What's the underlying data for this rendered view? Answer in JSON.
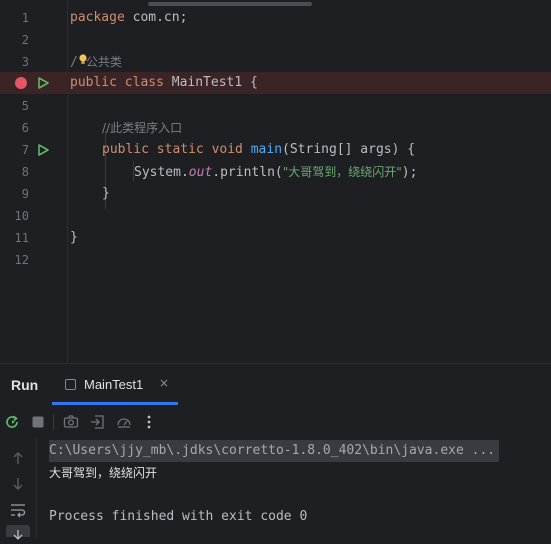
{
  "editor": {
    "line_numbers": [
      "1",
      "2",
      "3",
      "4",
      "5",
      "6",
      "7",
      "8",
      "9",
      "10",
      "11",
      "12"
    ],
    "code": {
      "l1_kw": "package",
      "l1_rest": " com.cn;",
      "l3_slash": "/",
      "l3_comment": "公共类",
      "l4_kw": "public class",
      "l4_rest": " MainTest1 {",
      "l6_comment": "//此类程序入口",
      "l7_kw": "public static void",
      "l7_method": "main",
      "l7_rest": "(String[] args) {",
      "l8_sys": "System.",
      "l8_out": "out",
      "l8_println": ".println(",
      "l8_string": "\"大哥驾到，绕绕闪开\"",
      "l8_end": ");",
      "l9_brace": "}",
      "l11_brace": "}"
    }
  },
  "run_panel": {
    "title": "Run",
    "tab_label": "MainTest1",
    "tab_close": "×"
  },
  "console": {
    "command": "C:\\Users\\jjy_mb\\.jdks\\corretto-1.8.0_402\\bin\\java.exe ...",
    "output": "大哥驾到，绕绕闪开",
    "exit": "Process finished with exit code 0"
  },
  "icons": {
    "breakpoint": "breakpoint-icon",
    "run_gutter": "run-gutter-icon",
    "bulb": "lightbulb-icon"
  },
  "colors": {
    "background": "#1e1f22",
    "keyword": "#cf8e6d",
    "string": "#6aab73",
    "method": "#56a8f5",
    "static_field": "#c77dbb",
    "breakpoint": "#e55765",
    "run_green": "#5fb865",
    "accent": "#3574f0"
  }
}
